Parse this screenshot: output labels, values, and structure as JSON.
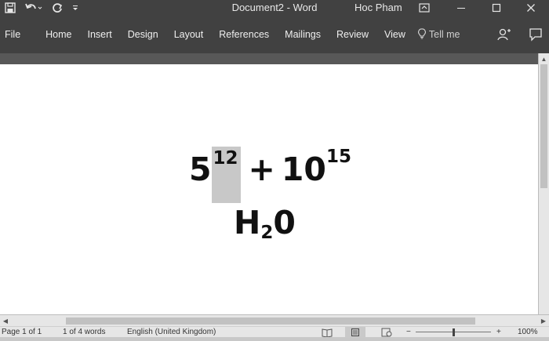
{
  "window": {
    "title": "Document2  -  Word",
    "user": "Hoc Pham"
  },
  "quick_access": {
    "icons": [
      "save-icon",
      "undo-icon",
      "redo-icon",
      "customize-qat-icon"
    ]
  },
  "ribbon": {
    "tabs": [
      "File",
      "Home",
      "Insert",
      "Design",
      "Layout",
      "References",
      "Mailings",
      "Review",
      "View"
    ],
    "tell_me": "Tell me"
  },
  "document": {
    "line1": {
      "base1": "5",
      "sup1": "12",
      "plus": "+",
      "base2": "10",
      "sup2": "15"
    },
    "line2": {
      "base": "H",
      "sub": "2",
      "tail": "0"
    }
  },
  "status": {
    "page": "Page 1 of 1",
    "words": "1 of 4 words",
    "language": "English (United Kingdom)",
    "zoom": "100%",
    "zoom_minus": "−",
    "zoom_plus": "+"
  }
}
